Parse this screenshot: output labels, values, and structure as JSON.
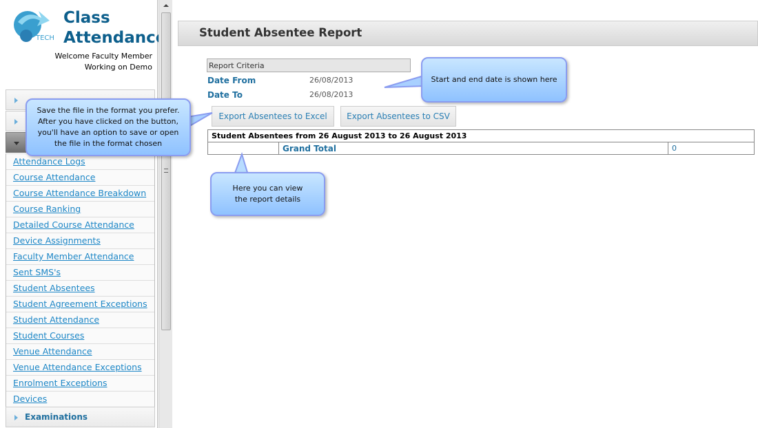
{
  "app": {
    "logo_text": "TECH",
    "title_line1": "Class",
    "title_line2": "Attendance",
    "welcome": "Welcome Faculty Member",
    "working_on": "Working on Demo"
  },
  "sidebar": {
    "sections": [
      {
        "label": "",
        "state": "collapsed"
      },
      {
        "label": "",
        "state": "collapsed"
      },
      {
        "label": "",
        "state": "expanded"
      }
    ],
    "links": [
      "Attendance Logs",
      "Course Attendance",
      "Course Attendance Breakdown",
      "Course Ranking",
      "Detailed Course Attendance",
      "Device Assignments",
      "Faculty Member Attendance",
      "Sent SMS's",
      "Student Absentees",
      "Student Agreement Exceptions",
      "Student Attendance",
      "Student Courses",
      "Venue Attendance",
      "Venue Attendance Exceptions",
      "Enrolment Exceptions",
      "Devices"
    ],
    "bottom_section": "Examinations"
  },
  "main": {
    "title": "Student Absentee Report",
    "criteria_header": "Report Criteria",
    "date_from_label": "Date From",
    "date_from": "26/08/2013",
    "date_to_label": "Date To",
    "date_to": "26/08/2013",
    "export_excel": "Export Absentees to Excel",
    "export_csv": "Export Absentees to CSV",
    "table": {
      "header": "Student Absentees from 26 August 2013 to 26 August 2013",
      "row": {
        "c1": "",
        "c2": "Grand Total",
        "c3": "0"
      }
    }
  },
  "callouts": {
    "export": "Save the file in the format you prefer. After you have clicked on the button, you'll have an option to save or open the file in the format chosen",
    "dates": "Start and end date is shown here",
    "details": "Here you can view the report details"
  },
  "colors": {
    "brand": "#0d5f8c",
    "link": "#1c86c6",
    "callout": "#a8d4ff"
  }
}
